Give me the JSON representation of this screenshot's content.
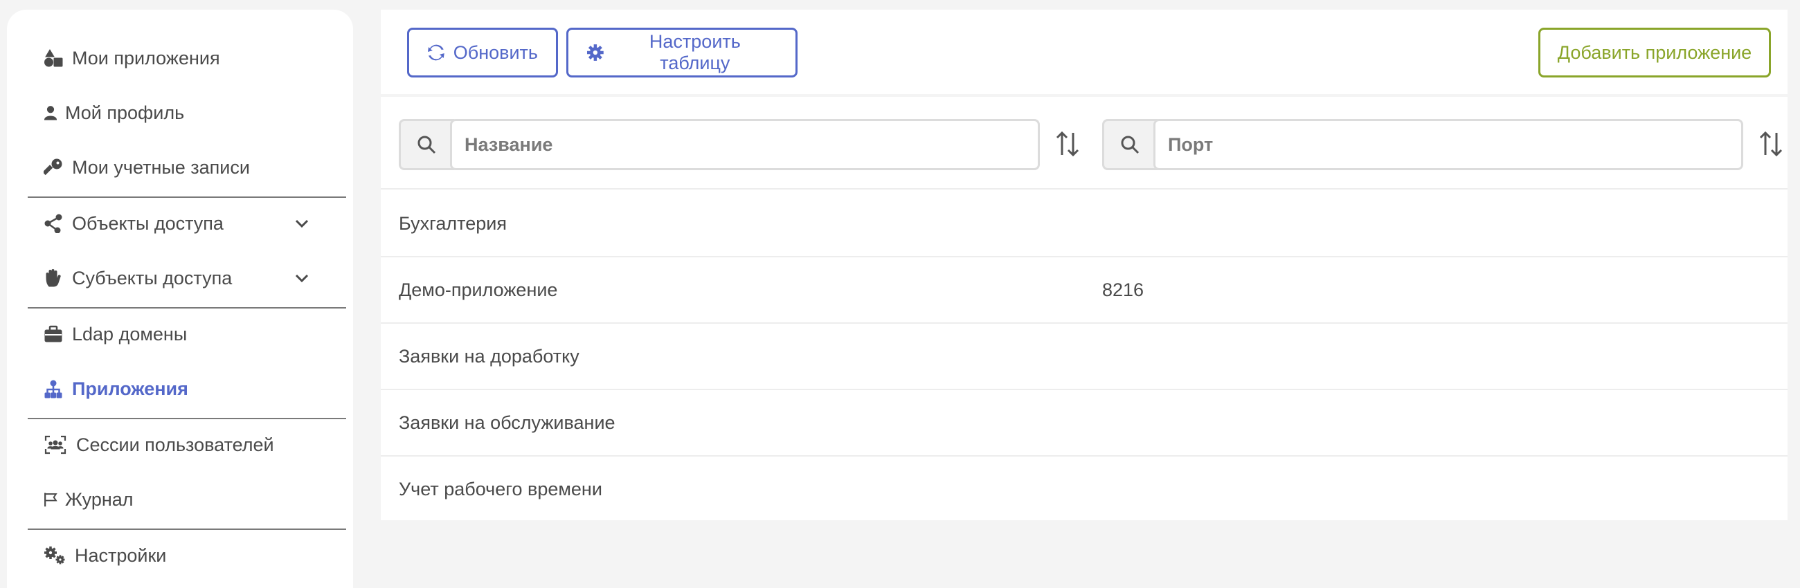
{
  "sidebar": {
    "items": [
      {
        "label": "Мои приложения",
        "icon": "shapes-icon"
      },
      {
        "label": "Мой профиль",
        "icon": "user-icon"
      },
      {
        "label": "Мои учетные записи",
        "icon": "key-icon"
      },
      {
        "label": "Объекты доступа",
        "icon": "share-nodes-icon",
        "expandable": true
      },
      {
        "label": "Субъекты доступа",
        "icon": "hand-icon",
        "expandable": true
      },
      {
        "label": "Ldap домены",
        "icon": "briefcase-icon"
      },
      {
        "label": "Приложения",
        "icon": "sitemap-icon",
        "active": true
      },
      {
        "label": "Сессии пользователей",
        "icon": "users-frame-icon"
      },
      {
        "label": "Журнал",
        "icon": "flag-icon"
      },
      {
        "label": "Настройки",
        "icon": "gears-icon"
      }
    ]
  },
  "toolbar": {
    "refresh_label": "Обновить",
    "configure_label": "Настроить таблицу",
    "add_label": "Добавить приложение"
  },
  "filters": {
    "name_placeholder": "Название",
    "port_placeholder": "Порт"
  },
  "table": {
    "rows": [
      {
        "name": "Бухгалтерия",
        "port": ""
      },
      {
        "name": "Демо-приложение",
        "port": "8216"
      },
      {
        "name": "Заявки на доработку",
        "port": ""
      },
      {
        "name": "Заявки на обслуживание",
        "port": ""
      },
      {
        "name": "Учет рабочего времени",
        "port": ""
      }
    ]
  },
  "colors": {
    "accent": "#5468c9",
    "add_button": "#8aa52a",
    "text": "#4a4a4a",
    "background": "#f4f4f4"
  }
}
